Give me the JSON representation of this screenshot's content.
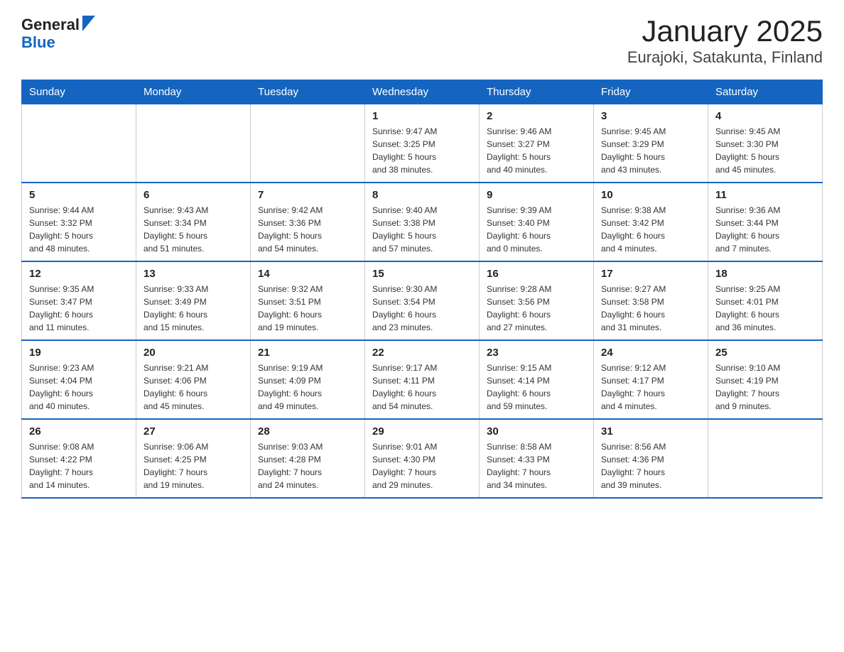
{
  "header": {
    "logo_general": "General",
    "logo_blue": "Blue",
    "month_title": "January 2025",
    "subtitle": "Eurajoki, Satakunta, Finland"
  },
  "weekdays": [
    "Sunday",
    "Monday",
    "Tuesday",
    "Wednesday",
    "Thursday",
    "Friday",
    "Saturday"
  ],
  "weeks": [
    [
      {
        "day": "",
        "info": ""
      },
      {
        "day": "",
        "info": ""
      },
      {
        "day": "",
        "info": ""
      },
      {
        "day": "1",
        "info": "Sunrise: 9:47 AM\nSunset: 3:25 PM\nDaylight: 5 hours\nand 38 minutes."
      },
      {
        "day": "2",
        "info": "Sunrise: 9:46 AM\nSunset: 3:27 PM\nDaylight: 5 hours\nand 40 minutes."
      },
      {
        "day": "3",
        "info": "Sunrise: 9:45 AM\nSunset: 3:29 PM\nDaylight: 5 hours\nand 43 minutes."
      },
      {
        "day": "4",
        "info": "Sunrise: 9:45 AM\nSunset: 3:30 PM\nDaylight: 5 hours\nand 45 minutes."
      }
    ],
    [
      {
        "day": "5",
        "info": "Sunrise: 9:44 AM\nSunset: 3:32 PM\nDaylight: 5 hours\nand 48 minutes."
      },
      {
        "day": "6",
        "info": "Sunrise: 9:43 AM\nSunset: 3:34 PM\nDaylight: 5 hours\nand 51 minutes."
      },
      {
        "day": "7",
        "info": "Sunrise: 9:42 AM\nSunset: 3:36 PM\nDaylight: 5 hours\nand 54 minutes."
      },
      {
        "day": "8",
        "info": "Sunrise: 9:40 AM\nSunset: 3:38 PM\nDaylight: 5 hours\nand 57 minutes."
      },
      {
        "day": "9",
        "info": "Sunrise: 9:39 AM\nSunset: 3:40 PM\nDaylight: 6 hours\nand 0 minutes."
      },
      {
        "day": "10",
        "info": "Sunrise: 9:38 AM\nSunset: 3:42 PM\nDaylight: 6 hours\nand 4 minutes."
      },
      {
        "day": "11",
        "info": "Sunrise: 9:36 AM\nSunset: 3:44 PM\nDaylight: 6 hours\nand 7 minutes."
      }
    ],
    [
      {
        "day": "12",
        "info": "Sunrise: 9:35 AM\nSunset: 3:47 PM\nDaylight: 6 hours\nand 11 minutes."
      },
      {
        "day": "13",
        "info": "Sunrise: 9:33 AM\nSunset: 3:49 PM\nDaylight: 6 hours\nand 15 minutes."
      },
      {
        "day": "14",
        "info": "Sunrise: 9:32 AM\nSunset: 3:51 PM\nDaylight: 6 hours\nand 19 minutes."
      },
      {
        "day": "15",
        "info": "Sunrise: 9:30 AM\nSunset: 3:54 PM\nDaylight: 6 hours\nand 23 minutes."
      },
      {
        "day": "16",
        "info": "Sunrise: 9:28 AM\nSunset: 3:56 PM\nDaylight: 6 hours\nand 27 minutes."
      },
      {
        "day": "17",
        "info": "Sunrise: 9:27 AM\nSunset: 3:58 PM\nDaylight: 6 hours\nand 31 minutes."
      },
      {
        "day": "18",
        "info": "Sunrise: 9:25 AM\nSunset: 4:01 PM\nDaylight: 6 hours\nand 36 minutes."
      }
    ],
    [
      {
        "day": "19",
        "info": "Sunrise: 9:23 AM\nSunset: 4:04 PM\nDaylight: 6 hours\nand 40 minutes."
      },
      {
        "day": "20",
        "info": "Sunrise: 9:21 AM\nSunset: 4:06 PM\nDaylight: 6 hours\nand 45 minutes."
      },
      {
        "day": "21",
        "info": "Sunrise: 9:19 AM\nSunset: 4:09 PM\nDaylight: 6 hours\nand 49 minutes."
      },
      {
        "day": "22",
        "info": "Sunrise: 9:17 AM\nSunset: 4:11 PM\nDaylight: 6 hours\nand 54 minutes."
      },
      {
        "day": "23",
        "info": "Sunrise: 9:15 AM\nSunset: 4:14 PM\nDaylight: 6 hours\nand 59 minutes."
      },
      {
        "day": "24",
        "info": "Sunrise: 9:12 AM\nSunset: 4:17 PM\nDaylight: 7 hours\nand 4 minutes."
      },
      {
        "day": "25",
        "info": "Sunrise: 9:10 AM\nSunset: 4:19 PM\nDaylight: 7 hours\nand 9 minutes."
      }
    ],
    [
      {
        "day": "26",
        "info": "Sunrise: 9:08 AM\nSunset: 4:22 PM\nDaylight: 7 hours\nand 14 minutes."
      },
      {
        "day": "27",
        "info": "Sunrise: 9:06 AM\nSunset: 4:25 PM\nDaylight: 7 hours\nand 19 minutes."
      },
      {
        "day": "28",
        "info": "Sunrise: 9:03 AM\nSunset: 4:28 PM\nDaylight: 7 hours\nand 24 minutes."
      },
      {
        "day": "29",
        "info": "Sunrise: 9:01 AM\nSunset: 4:30 PM\nDaylight: 7 hours\nand 29 minutes."
      },
      {
        "day": "30",
        "info": "Sunrise: 8:58 AM\nSunset: 4:33 PM\nDaylight: 7 hours\nand 34 minutes."
      },
      {
        "day": "31",
        "info": "Sunrise: 8:56 AM\nSunset: 4:36 PM\nDaylight: 7 hours\nand 39 minutes."
      },
      {
        "day": "",
        "info": ""
      }
    ]
  ]
}
